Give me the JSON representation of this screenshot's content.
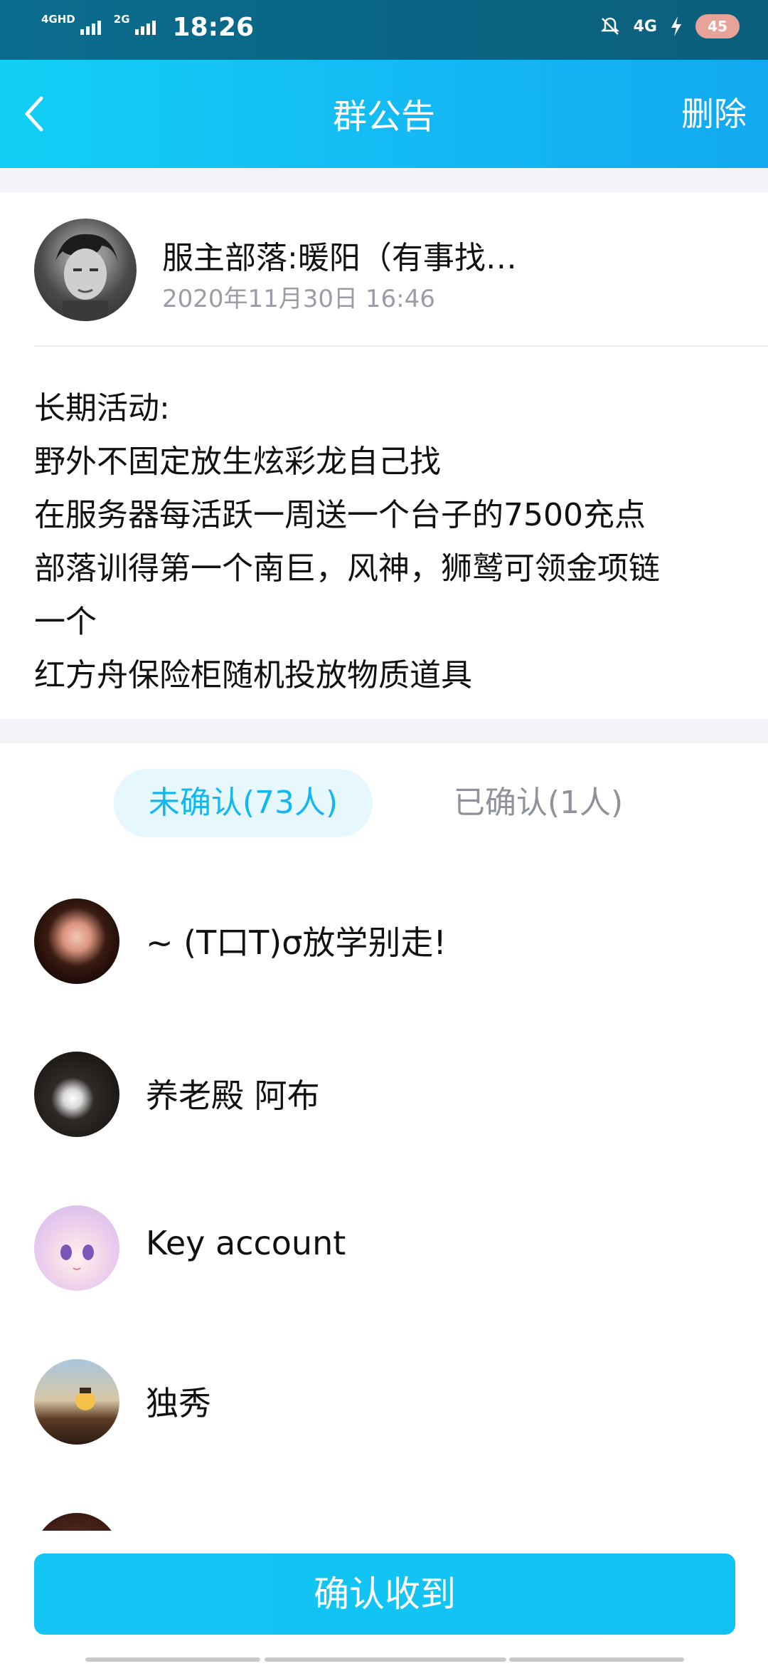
{
  "status_bar": {
    "network1": "4GHD",
    "network2": "2G",
    "time": "18:26",
    "network3": "4G",
    "battery": "45"
  },
  "header": {
    "title": "群公告",
    "delete_label": "删除"
  },
  "announcement": {
    "author_name": "服主部落:暖阳（有事找…",
    "timestamp": "2020年11月30日 16:46",
    "lines": [
      "长期活动:",
      "野外不固定放生炫彩龙自己找",
      "在服务器每活跃一周送一个台子的7500充点",
      "部落训得第一个南巨，风神，狮鹫可领金项链",
      "一个",
      "红方舟保险柜随机投放物质道具"
    ]
  },
  "tabs": {
    "unconfirmed": "未确认(73人)",
    "confirmed": "已确认(1人)"
  },
  "members": [
    {
      "name": " ~ (T口T)σ放学别走!"
    },
    {
      "name": "养老殿 阿布"
    },
    {
      "name": "Key account"
    },
    {
      "name": "独秀"
    },
    {
      "name": ""
    }
  ],
  "confirm_button": "确认收到",
  "colors": {
    "accent": "#10b8ef",
    "header_start": "#12d0f5",
    "header_end": "#12a9f0",
    "secondary_text": "#9a9da6"
  }
}
